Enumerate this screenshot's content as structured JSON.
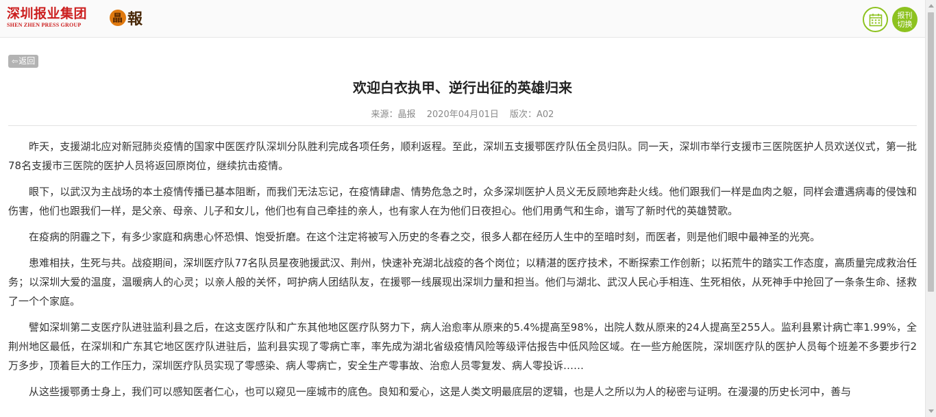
{
  "header": {
    "logo_cn": "深圳报业集团",
    "logo_en": "SHEN ZHEN PRESS GROUP",
    "jb_logo_mark": "晶",
    "jb_logo_text": "報",
    "switch_line1": "报刊",
    "switch_line2": "切换",
    "calendar_icon": "calendar-icon",
    "accent_color": "#8dc21f",
    "brand_color": "#cc1f1f"
  },
  "nav": {
    "back_label": "返回",
    "back_icon": "arrow-left-icon"
  },
  "article": {
    "title": "欢迎白衣执甲、逆行出征的英雄归来",
    "source": "来源：晶报",
    "date": "2020年04月01日",
    "edition": "版次：A02",
    "paragraphs": [
      "昨天，支援湖北应对新冠肺炎疫情的国家中医医疗队深圳分队胜利完成各项任务，顺利返程。至此，深圳五支援鄂医疗队伍全员归队。同一天，深圳市举行支援市三医院医护人员欢送仪式，第一批78名支援市三医院的医护人员将返回原岗位，继续抗击疫情。",
      "眼下，以武汉为主战场的本土疫情传播已基本阻断，而我们无法忘记，在疫情肆虐、情势危急之时，众多深圳医护人员义无反顾地奔赴火线。他们跟我们一样是血肉之躯，同样会遭遇病毒的侵蚀和伤害，他们也跟我们一样，是父亲、母亲、儿子和女儿，他们也有自己牵挂的亲人，也有家人在为他们日夜担心。他们用勇气和生命，谱写了新时代的英雄赞歌。",
      "在疫病的阴霾之下，有多少家庭和病患心怀恐惧、饱受折磨。在这个注定将被写入历史的冬春之交，很多人都在经历人生中的至暗时刻，而医者，则是他们眼中最神圣的光亮。",
      "患难相扶，生死与共。战疫期间，深圳医疗队77名队员星夜驰援武汉、荆州，快速补充湖北战疫的各个岗位；以精湛的医疗技术，不断探索工作创新；以拓荒牛的踏实工作态度，高质量完成救治任务；以深圳大爱的温度，温暖病人的心灵；以亲人般的关怀，呵护病人团结队友，在援鄂一线展现出深圳力量和担当。他们与湖北、武汉人民心手相连、生死相依，从死神手中抢回了一条条生命、拯救了一个个家庭。",
      "譬如深圳第二支医疗队进驻监利县之后，在这支医疗队和广东其他地区医疗队努力下，病人治愈率从原来的5.4%提高至98%，出院人数从原来的24人提高至255人。监利县累计病亡率1.99%，全荆州地区最低，在深圳和广东其它地区医疗队进驻后，监利县实现了零病亡率，率先成为湖北省级疫情风险等级评估报告中低风险区域。在一些方舱医院，深圳医疗队的医护人员每个班差不多要步行2万多步，顶着巨大的工作压力，深圳医疗队员实现了零感染、病人零病亡，安全生产零事故、治愈人员零复发、病人零投诉……",
      "从这些援鄂勇士身上，我们可以感知医者仁心，也可以窥见一座城市的底色。良知和爱心，这是人类文明最底层的逻辑，也是人之所以为人的秘密与证明。在漫漫的历史长河中，善与"
    ]
  }
}
